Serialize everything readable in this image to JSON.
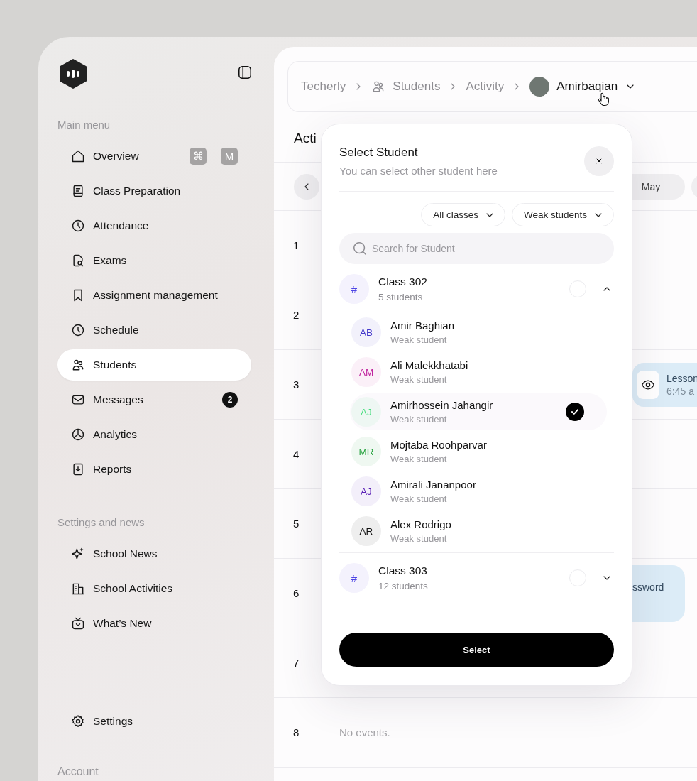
{
  "sidebar": {
    "main_menu_label": "Main menu",
    "shortcut_keys": [
      "⌘",
      "M"
    ],
    "main_items": [
      {
        "label": "Overview",
        "selected": false
      },
      {
        "label": "Class Preparation",
        "selected": false
      },
      {
        "label": "Attendance",
        "selected": false
      },
      {
        "label": "Exams",
        "selected": false
      },
      {
        "label": "Assignment management",
        "selected": false
      },
      {
        "label": "Schedule",
        "selected": false
      },
      {
        "label": "Students",
        "selected": true
      },
      {
        "label": "Messages",
        "selected": false,
        "badge": "2"
      },
      {
        "label": "Analytics",
        "selected": false
      },
      {
        "label": "Reports",
        "selected": false
      }
    ],
    "settings_label": "Settings and news",
    "settings_items": [
      {
        "label": "School News",
        "selected": false
      },
      {
        "label": "School Activities",
        "selected": false
      },
      {
        "label": "What’s New",
        "selected": false
      }
    ],
    "bottom_item": {
      "label": "Settings",
      "selected": false
    },
    "account_label": "Account"
  },
  "breadcrumb": {
    "items": [
      "Techerly",
      "Students",
      "Activity"
    ],
    "current": "Amirbaqian"
  },
  "page_title": "Acti",
  "month_nav": {
    "months": [
      {
        "label": "May",
        "selected": false
      }
    ]
  },
  "rows": [
    {
      "number": "1"
    },
    {
      "number": "2"
    },
    {
      "number": "3",
      "event": {
        "kind": "lesson",
        "title": "Lesson",
        "time": "6:45 a"
      }
    },
    {
      "number": "4"
    },
    {
      "number": "5"
    },
    {
      "number": "6",
      "event": {
        "kind": "note",
        "title": "ssword"
      }
    },
    {
      "number": "7"
    },
    {
      "number": "8",
      "empty_text": "No events."
    }
  ],
  "dialog": {
    "title": "Select Student",
    "subtitle": "You can select other student here",
    "filters": [
      "All classes",
      "Weak students"
    ],
    "search": {
      "placeholder": "Search for Student"
    },
    "classes": [
      {
        "icon_text": "#",
        "name": "Class 302",
        "count": "5 students",
        "selected": false,
        "expanded": true,
        "students": [
          {
            "initials": "AB",
            "name": "Amir Baghian",
            "note": "Weak student",
            "color": "#4338ca",
            "selected": false
          },
          {
            "initials": "AM",
            "name": "Ali Malekkhatabi",
            "note": "Weak student",
            "color": "#c0269f",
            "selected": false
          },
          {
            "initials": "AJ",
            "name": "Amirhossein Jahangir",
            "note": "Weak student",
            "color": "#4ade80",
            "selected": true
          },
          {
            "initials": "MR",
            "name": "Mojtaba Roohparvar",
            "note": "Weak student",
            "color": "#22a03a",
            "selected": false
          },
          {
            "initials": "AJ",
            "name": "Amirali Jananpoor",
            "note": "Weak student",
            "color": "#5b21b6",
            "selected": false
          },
          {
            "initials": "AR",
            "name": "Alex Rodrigo",
            "note": "Weak student",
            "color": "#111111",
            "selected": false
          }
        ]
      },
      {
        "icon_text": "#",
        "name": "Class 303",
        "count": "12 students",
        "selected": false,
        "expanded": false
      }
    ],
    "button": "Select"
  }
}
